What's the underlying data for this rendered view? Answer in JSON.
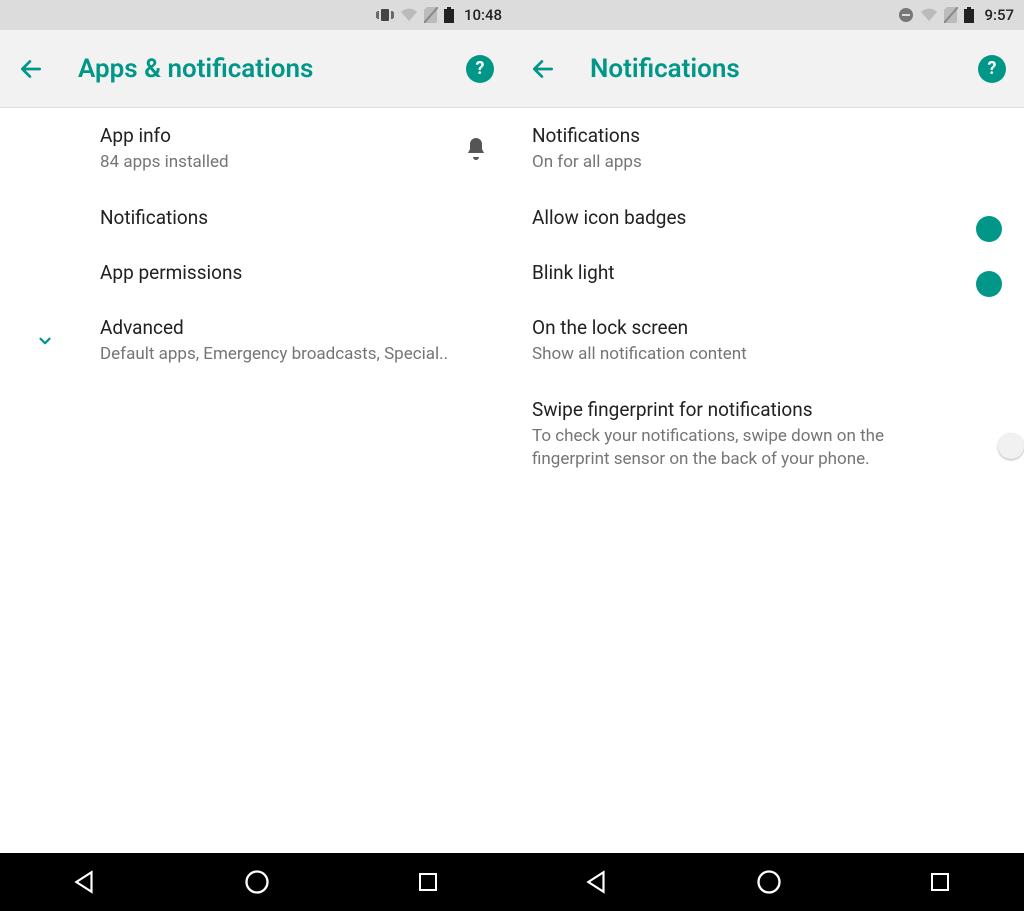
{
  "left": {
    "status": {
      "time": "10:48"
    },
    "appbar": {
      "title": "Apps & notifications"
    },
    "rows": {
      "appinfo": {
        "title": "App info",
        "sub": "84 apps installed"
      },
      "notif": {
        "title": "Notifications"
      },
      "perms": {
        "title": "App permissions"
      },
      "advanced": {
        "title": "Advanced",
        "sub": "Default apps, Emergency broadcasts, Special.."
      }
    }
  },
  "right": {
    "status": {
      "time": "9:57"
    },
    "appbar": {
      "title": "Notifications"
    },
    "rows": {
      "notif": {
        "title": "Notifications",
        "sub": "On for all apps"
      },
      "badges": {
        "title": "Allow icon badges"
      },
      "blink": {
        "title": "Blink light"
      },
      "lock": {
        "title": "On the lock screen",
        "sub": "Show all notification content"
      },
      "finger": {
        "title": "Swipe fingerprint for notifications",
        "sub": "To check your notifications, swipe down on the fingerprint sensor on the back of your phone."
      }
    }
  }
}
